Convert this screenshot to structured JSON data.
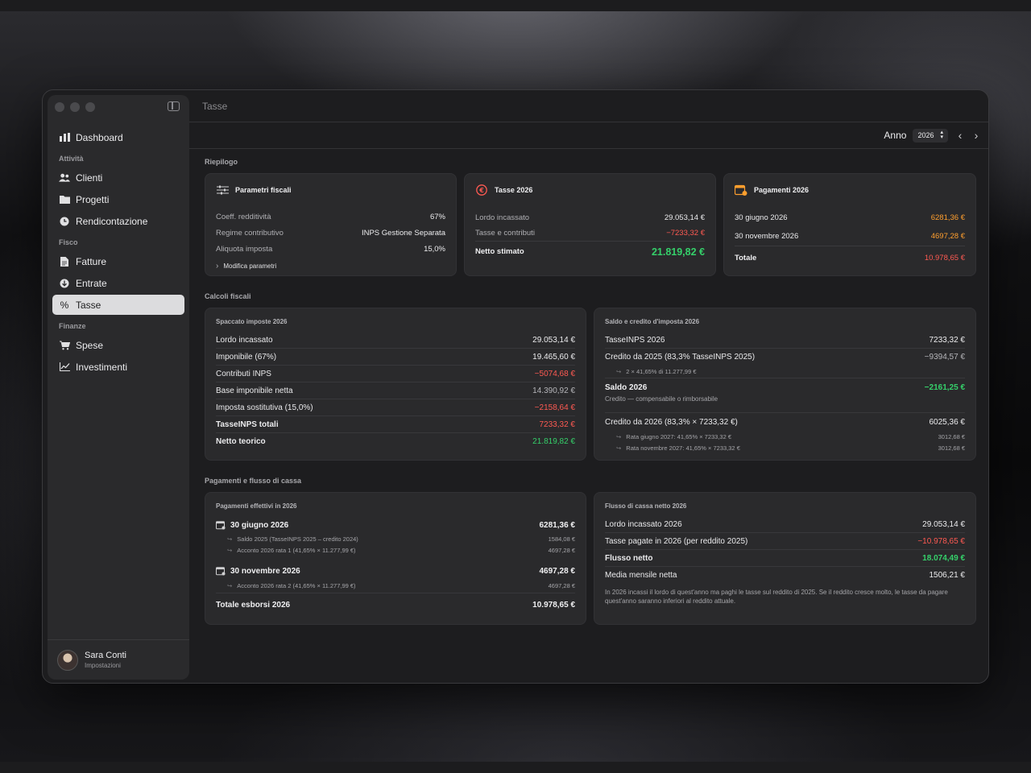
{
  "window": {
    "title": "Tasse"
  },
  "sidebar": {
    "top_item": {
      "label": "Dashboard",
      "icon": "chart-icon"
    },
    "sections": [
      {
        "title": "Attività",
        "items": [
          {
            "label": "Clienti",
            "icon": "people-icon"
          },
          {
            "label": "Progetti",
            "icon": "folder-icon"
          },
          {
            "label": "Rendicontazione",
            "icon": "clock-icon"
          }
        ]
      },
      {
        "title": "Fisco",
        "items": [
          {
            "label": "Fatture",
            "icon": "document-icon"
          },
          {
            "label": "Entrate",
            "icon": "arrow-down-circle-icon"
          },
          {
            "label": "Tasse",
            "icon": "percent-icon",
            "active": true
          }
        ]
      },
      {
        "title": "Finanze",
        "items": [
          {
            "label": "Spese",
            "icon": "cart-icon"
          },
          {
            "label": "Investimenti",
            "icon": "trend-icon"
          }
        ]
      }
    ],
    "user": {
      "name": "Sara Conti",
      "subtitle": "Impostazioni"
    }
  },
  "toolbar": {
    "year_label": "Anno",
    "year_value": "2026"
  },
  "riepilogo": {
    "title": "Riepilogo",
    "parametri": {
      "title": "Parametri fiscali",
      "rows": [
        {
          "k": "Coeff. redditività",
          "v": "67%"
        },
        {
          "k": "Regime contributivo",
          "v": "INPS Gestione Separata"
        },
        {
          "k": "Aliquota imposta",
          "v": "15,0%"
        }
      ],
      "link": "Modifica parametri"
    },
    "tasse": {
      "title": "Tasse 2026",
      "lordo_k": "Lordo incassato",
      "lordo_v": "29.053,14 €",
      "tasse_k": "Tasse e contributi",
      "tasse_v": "−7233,32 €",
      "netto_k": "Netto stimato",
      "netto_v": "21.819,82 €"
    },
    "pagamenti": {
      "title": "Pagamenti 2026",
      "r1_k": "30 giugno 2026",
      "r1_v": "6281,36 €",
      "r2_k": "30 novembre 2026",
      "r2_v": "4697,28 €",
      "tot_k": "Totale",
      "tot_v": "10.978,65 €"
    }
  },
  "calcoli": {
    "title": "Calcoli fiscali",
    "spaccato": {
      "title": "Spaccato imposte 2026",
      "rows": [
        {
          "k": "Lordo incassato",
          "v": "29.053,14 €"
        },
        {
          "k": "Imponibile (67%)",
          "v": "19.465,60 €"
        },
        {
          "k": "Contributi INPS",
          "v": "−5074,68 €"
        },
        {
          "k": "Base imponibile netta",
          "v": "14.390,92 €"
        },
        {
          "k": "Imposta sostitutiva (15,0%)",
          "v": "−2158,64 €"
        },
        {
          "k": "TasseINPS totali",
          "v": "7233,32 €"
        },
        {
          "k": "Netto teorico",
          "v": "21.819,82 €"
        }
      ]
    },
    "saldo": {
      "title": "Saldo e credito d'imposta 2026",
      "r1_k": "TasseINPS 2026",
      "r1_v": "7233,32 €",
      "r2_k": "Credito da 2025 (83,3% TasseINPS 2025)",
      "r2_v": "−9394,57 €",
      "r2_sub": "2 × 41,65% di 11.277,99 €",
      "r3_k": "Saldo 2026",
      "r3_v": "−2161,25 €",
      "r3_sub": "Credito — compensabile o rimborsabile",
      "r4_k": "Credito da 2026 (83,3% × 7233,32 €)",
      "r4_v": "6025,36 €",
      "r4_sub1_k": "Rata giugno 2027: 41,65% × 7233,32 €",
      "r4_sub1_v": "3012,68 €",
      "r4_sub2_k": "Rata novembre 2027: 41,65% × 7233,32 €",
      "r4_sub2_v": "3012,68 €"
    }
  },
  "flusso_section": {
    "title": "Pagamenti e flusso di cassa",
    "pagamenti": {
      "title": "Pagamenti effettivi in 2026",
      "g_k": "30 giugno 2026",
      "g_v": "6281,36 €",
      "g_s1_k": "Saldo 2025 (TasseINPS 2025 – credito 2024)",
      "g_s1_v": "1584,08 €",
      "g_s2_k": "Acconto 2026 rata 1 (41,65% × 11.277,99 €)",
      "g_s2_v": "4697,28 €",
      "n_k": "30 novembre 2026",
      "n_v": "4697,28 €",
      "n_s1_k": "Acconto 2026 rata 2 (41,65% × 11.277,99 €)",
      "n_s1_v": "4697,28 €",
      "tot_k": "Totale esborsi 2026",
      "tot_v": "10.978,65 €"
    },
    "flusso": {
      "title": "Flusso di cassa netto 2026",
      "rows": [
        {
          "k": "Lordo incassato 2026",
          "v": "29.053,14 €"
        },
        {
          "k": "Tasse pagate in 2026 (per reddito 2025)",
          "v": "−10.978,65 €"
        },
        {
          "k": "Flusso netto",
          "v": "18.074,49 €"
        },
        {
          "k": "Media mensile netta",
          "v": "1506,21 €"
        }
      ],
      "note": "In 2026 incassi il lordo di quest'anno ma paghi le tasse sul reddito di 2025. Se il reddito cresce molto, le tasse da pagare quest'anno saranno inferiori al reddito attuale."
    }
  },
  "colors": {
    "negative": "#ff5a52",
    "positive": "#35d06a",
    "accent_orange": "#ff9f2e"
  }
}
